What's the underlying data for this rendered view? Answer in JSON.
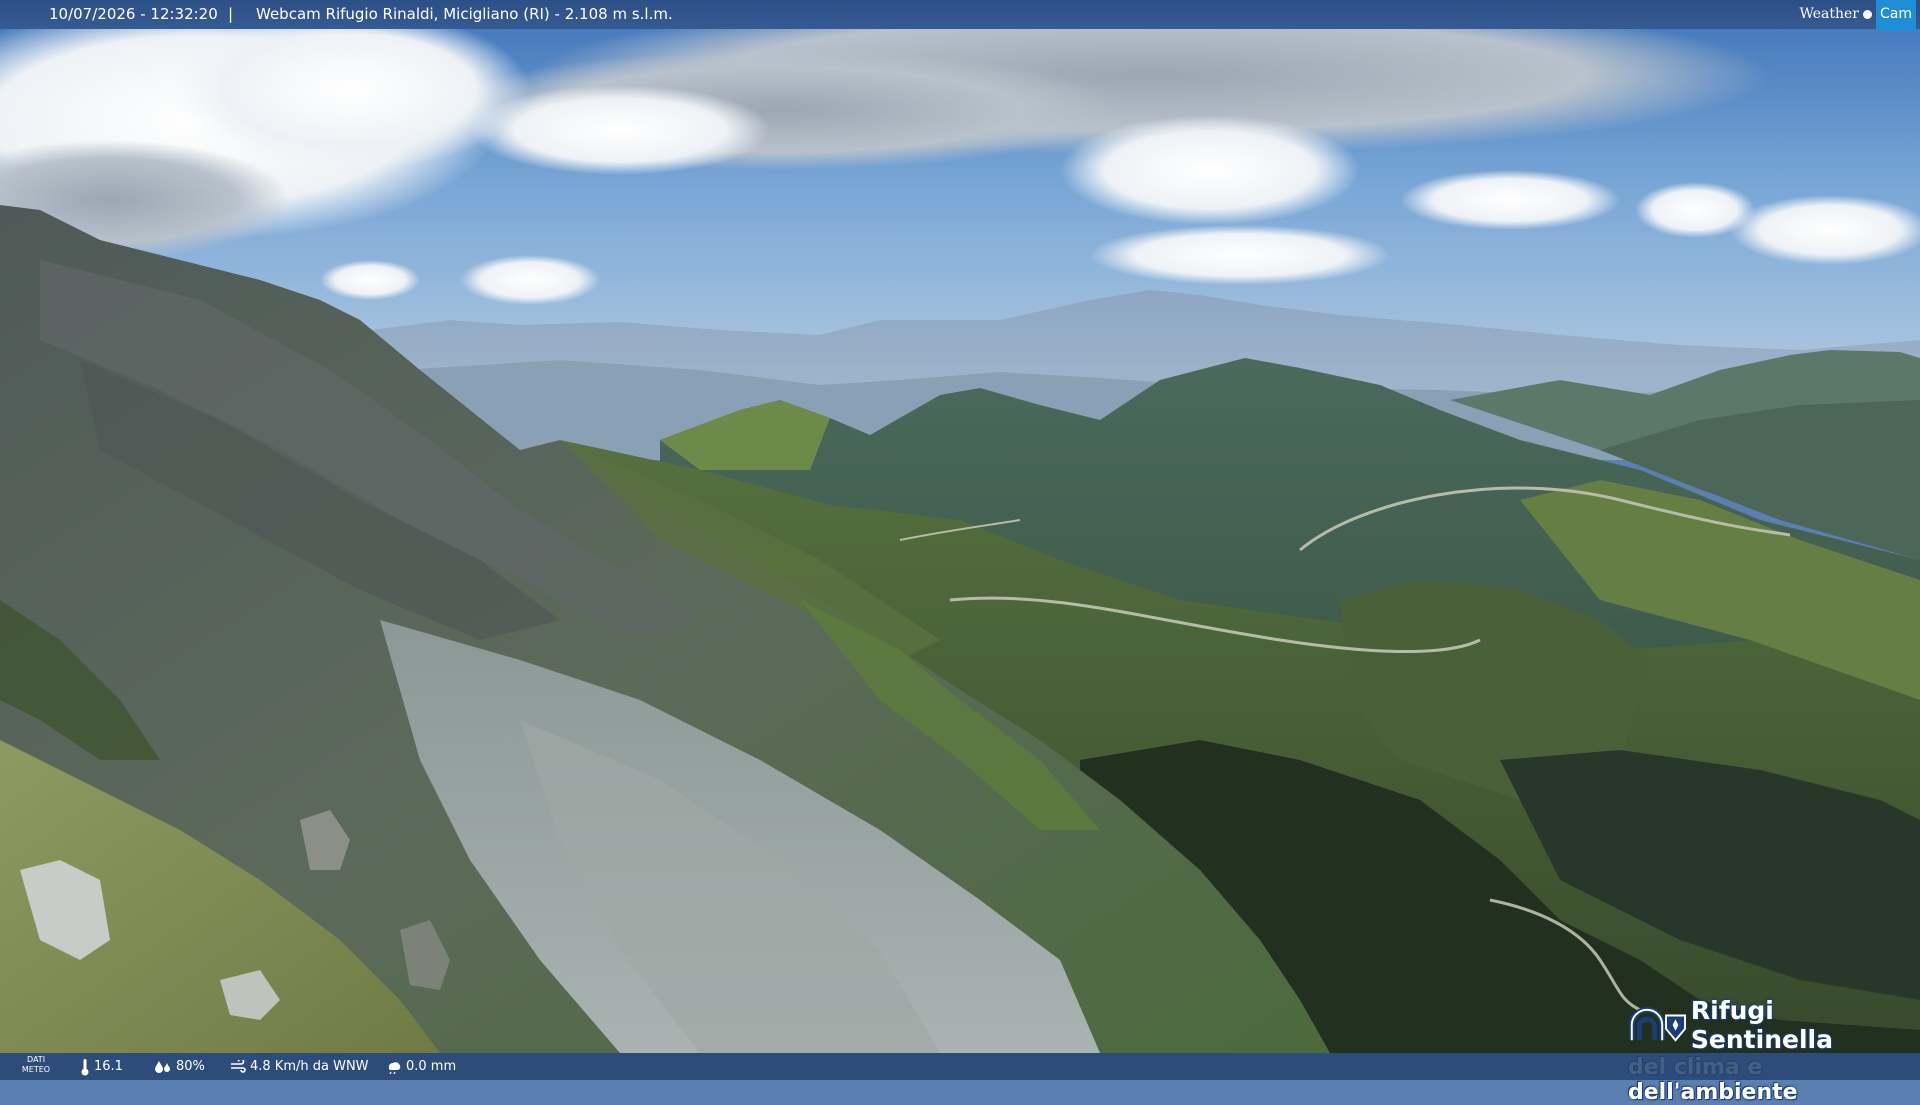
{
  "header": {
    "timestamp": "10/07/2026 - 12:32:20",
    "separator": "|",
    "title": "Webcam Rifugio Rinaldi, Micigliano (RI) - 2.108 m s.l.m."
  },
  "brand": {
    "left": "Weather",
    "right": "Cam",
    "accent_color": "#1e8fd6"
  },
  "weather": {
    "label_line1": "DATI",
    "label_line2": "METEO",
    "temperature": "16.1",
    "humidity": "80%",
    "wind": "4.8 Km/h da WNW",
    "rain": "0.0 mm"
  },
  "logo": {
    "line1": "Rifugi Sentinella",
    "line2": "del clima e dell'ambiente"
  }
}
